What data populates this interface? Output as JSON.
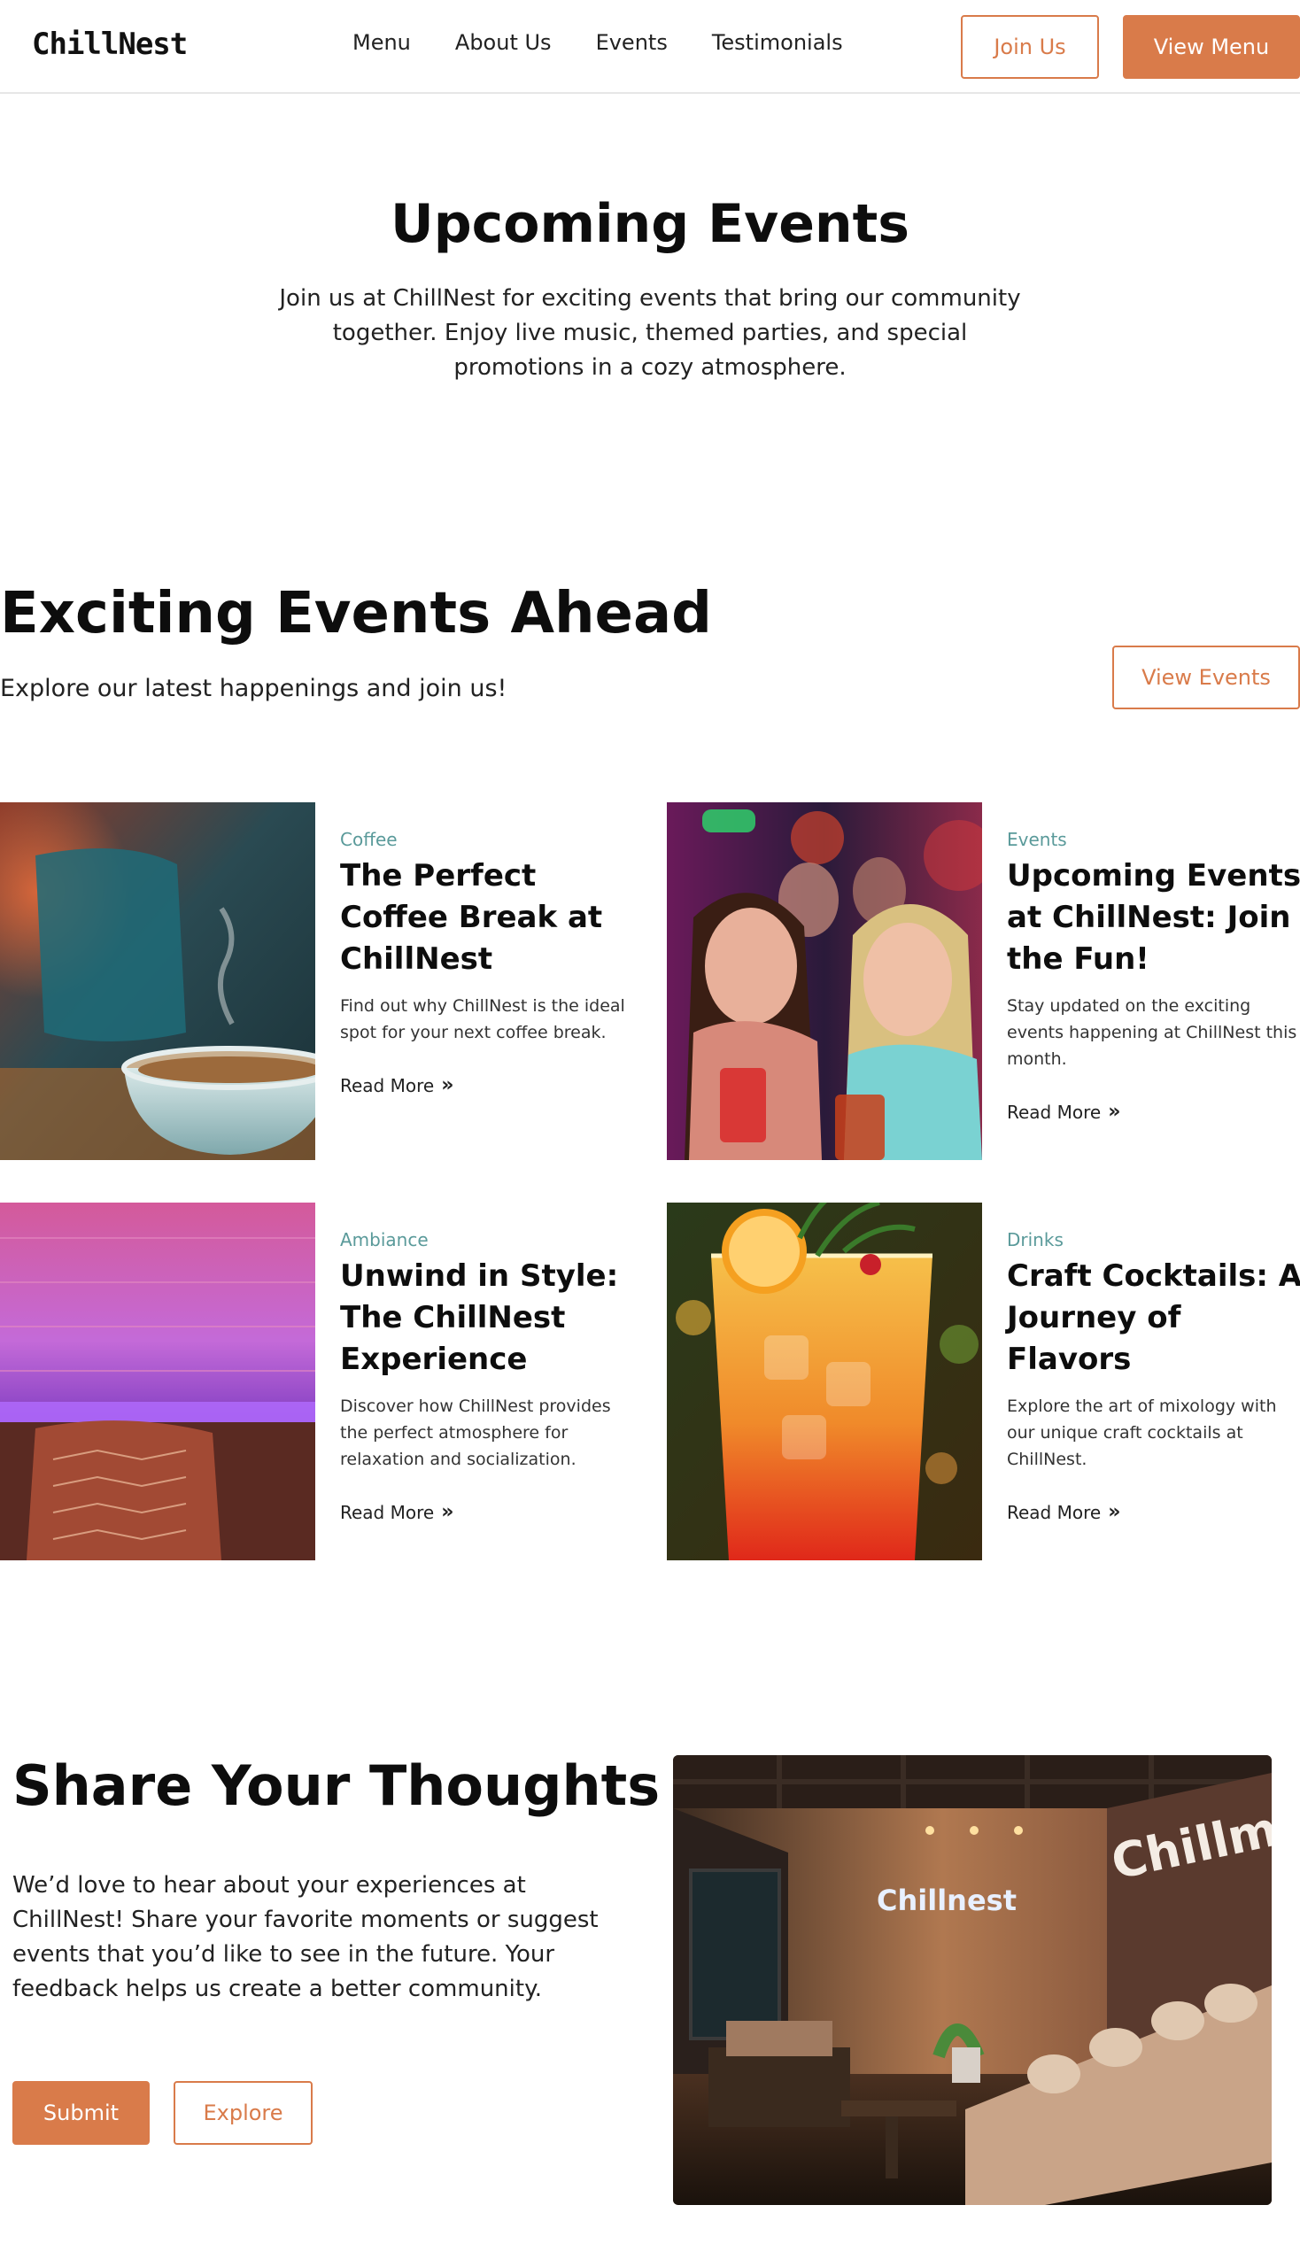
{
  "nav": {
    "logo": "ChillNest",
    "links": [
      "Menu",
      "About Us",
      "Events",
      "Testimonials"
    ],
    "join_label": "Join Us",
    "view_menu_label": "View Menu"
  },
  "hero": {
    "title": "Upcoming Events",
    "text": "Join us at ChillNest for exciting events that bring our community together. Enjoy live music, themed parties, and special promotions in a cozy atmosphere."
  },
  "events": {
    "title": "Exciting Events Ahead",
    "subtitle": "Explore our latest happenings and join us!",
    "button_label": "View Events",
    "cards": [
      {
        "category": "Coffee",
        "title": "The Perfect Coffee Break at ChillNest",
        "description": "Find out why ChillNest is the ideal spot for your next coffee break.",
        "link": "Read More"
      },
      {
        "category": "Events",
        "title": "Upcoming Events at ChillNest: Join the Fun!",
        "description": "Stay updated on the exciting events happening at ChillNest this month.",
        "link": "Read More"
      },
      {
        "category": "Ambiance",
        "title": "Unwind in Style: The ChillNest Experience",
        "description": "Discover how ChillNest provides the perfect atmosphere for relaxation and socialization.",
        "link": "Read More"
      },
      {
        "category": "Drinks",
        "title": "Craft Cocktails: A Journey of Flavors",
        "description": "Explore the art of mixology with our unique craft cocktails at ChillNest.",
        "link": "Read More"
      }
    ]
  },
  "thoughts": {
    "title": "Share Your Thoughts",
    "text": "We’d love to hear about your experiences at ChillNest! Share your favorite moments or suggest events that you’d like to see in the future. Your feedback helps us create a better community.",
    "submit_label": "Submit",
    "explore_label": "Explore",
    "image_signs": [
      "Chillnest",
      "Chillmsst"
    ]
  },
  "colors": {
    "accent": "#d97b4a",
    "category": "#5a9a9a",
    "text": "#111111"
  }
}
